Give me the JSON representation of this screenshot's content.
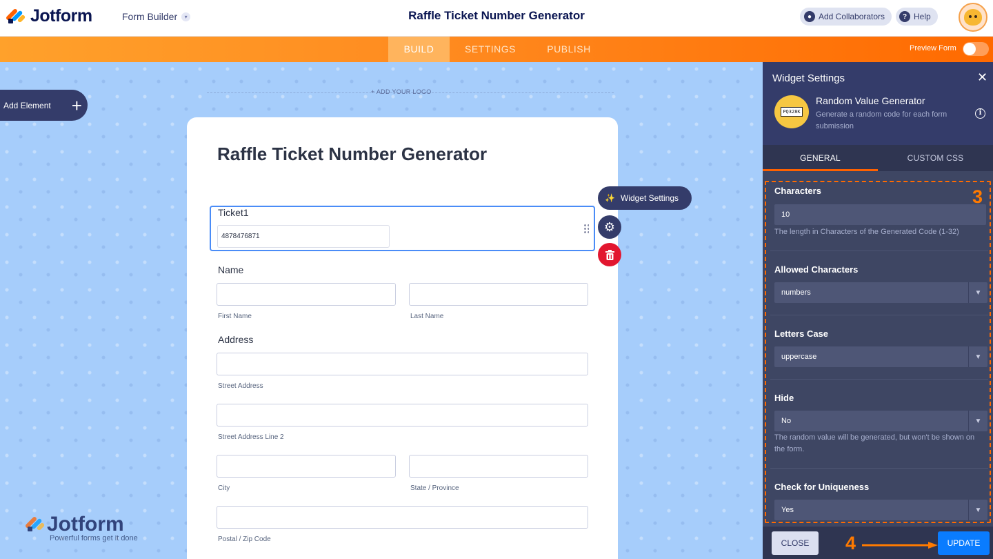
{
  "header": {
    "brand": "Jotform",
    "form_builder": "Form Builder",
    "title": "Raffle Ticket Number Generator",
    "add_collaborators": "Add Collaborators",
    "help": "Help"
  },
  "nav": {
    "tabs": [
      {
        "label": "BUILD",
        "active": true
      },
      {
        "label": "SETTINGS",
        "active": false
      },
      {
        "label": "PUBLISH",
        "active": false
      }
    ],
    "preview_label": "Preview Form",
    "preview_on": false
  },
  "canvas": {
    "add_element": "Add Element",
    "add_logo": "+ ADD YOUR LOGO",
    "watermark": "Jotform",
    "watermark_tagline": "Powerful forms get it done"
  },
  "form": {
    "title": "Raffle Ticket Number Generator",
    "ticket": {
      "label": "Ticket1",
      "value": "4878476871"
    },
    "name": {
      "label": "Name",
      "first": "First Name",
      "last": "Last Name"
    },
    "address": {
      "label": "Address",
      "street": "Street Address",
      "street2": "Street Address Line 2",
      "city": "City",
      "state": "State / Province",
      "postal": "Postal / Zip Code"
    }
  },
  "field_actions": {
    "widget_settings": "Widget Settings"
  },
  "panel": {
    "title": "Widget Settings",
    "widget_name": "Random Value Generator",
    "widget_desc": "Generate a random code for each form submission",
    "widget_thumb_text": "PQ328K",
    "tabs": [
      {
        "label": "GENERAL",
        "active": true
      },
      {
        "label": "CUSTOM CSS",
        "active": false
      }
    ],
    "fields": {
      "characters": {
        "label": "Characters",
        "value": "10",
        "help": "The length in Characters of the Generated Code (1-32)"
      },
      "allowed": {
        "label": "Allowed Characters",
        "value": "numbers"
      },
      "letters_case": {
        "label": "Letters Case",
        "value": "uppercase"
      },
      "hide": {
        "label": "Hide",
        "value": "No",
        "help": "The random value will be generated, but won't be shown on the form."
      },
      "uniqueness": {
        "label": "Check for Uniqueness",
        "value": "Yes"
      }
    },
    "close_label": "CLOSE",
    "update_label": "UPDATE"
  },
  "annotations": {
    "step3": "3",
    "step4": "4",
    "accent": "#ff7a00"
  }
}
